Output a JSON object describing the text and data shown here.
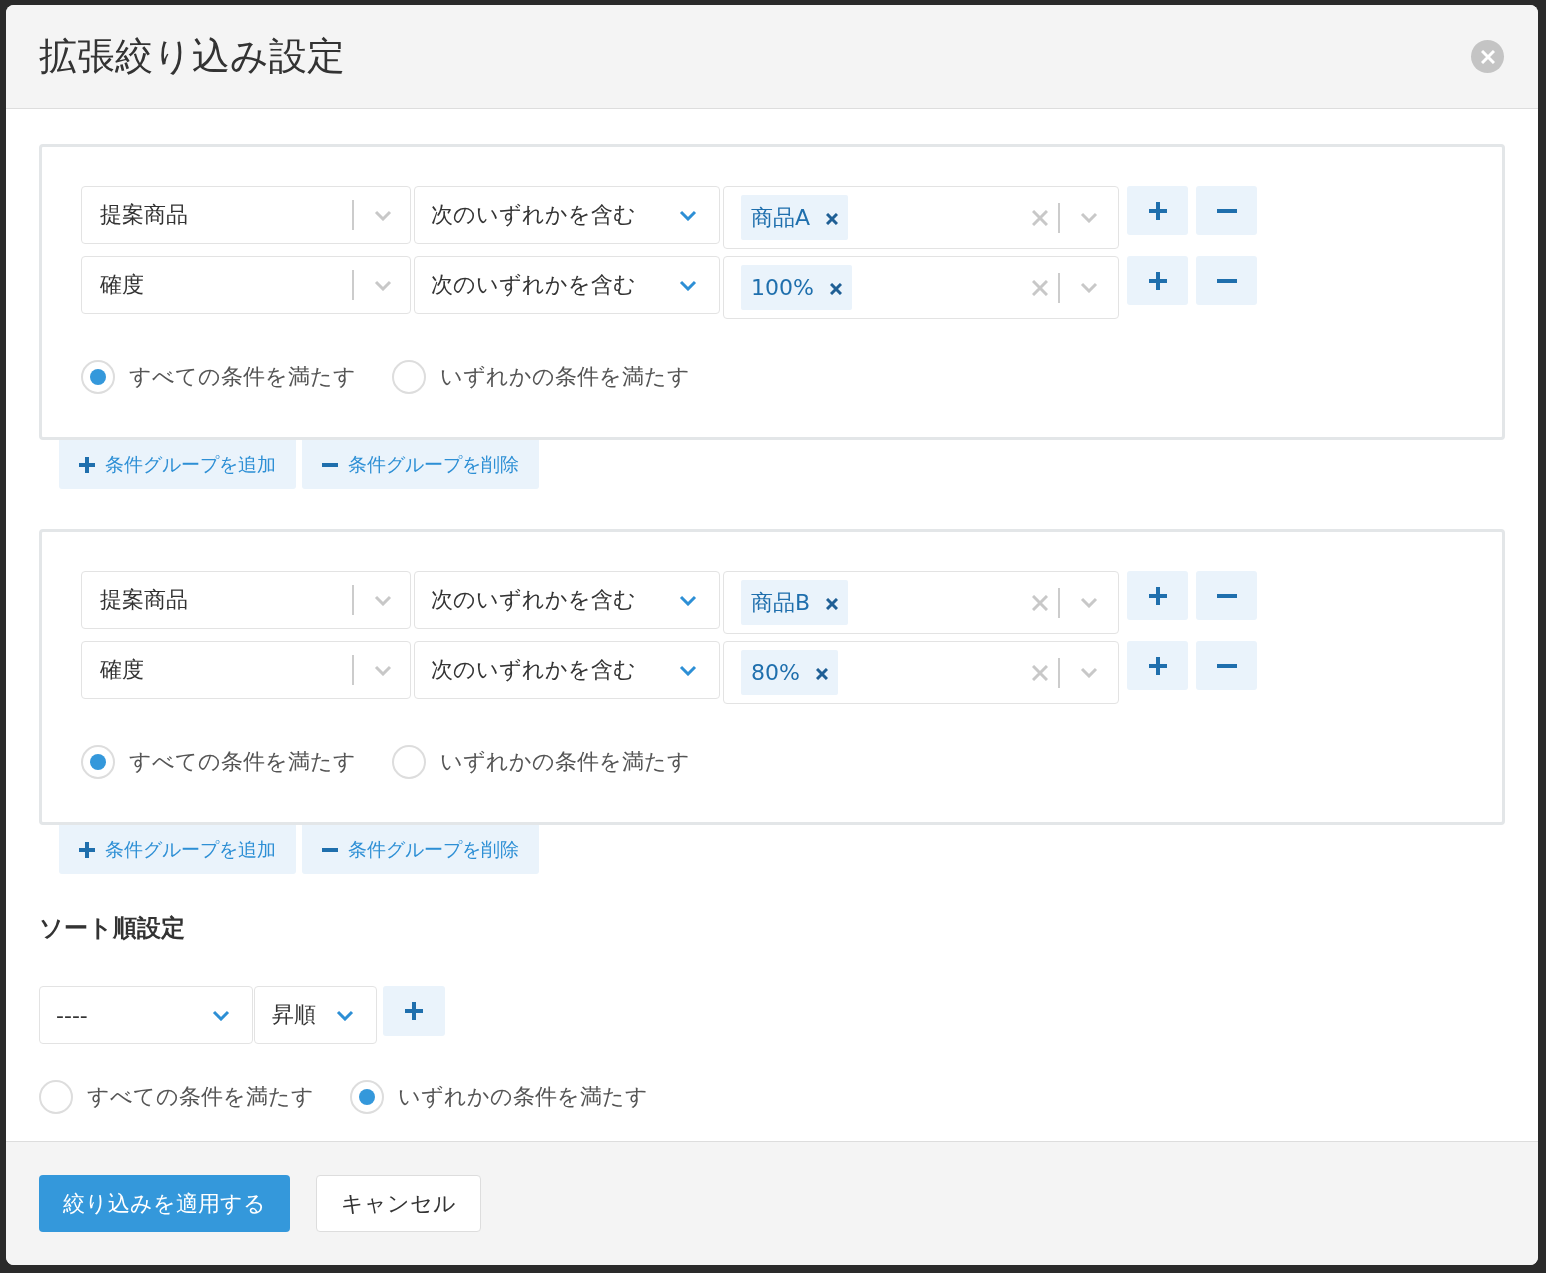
{
  "dialog": {
    "title": "拡張絞り込み設定"
  },
  "condition_groups": [
    {
      "conditions": [
        {
          "field": "提案商品",
          "operator": "次のいずれかを含む",
          "values": [
            "商品A"
          ]
        },
        {
          "field": "確度",
          "operator": "次のいずれかを含む",
          "values": [
            "100%"
          ]
        }
      ],
      "match_options": [
        {
          "label": "すべての条件を満たす",
          "selected": true
        },
        {
          "label": "いずれかの条件を満たす",
          "selected": false
        }
      ],
      "add_group_button": "条件グループを追加",
      "remove_group_button": "条件グループを削除"
    },
    {
      "conditions": [
        {
          "field": "提案商品",
          "operator": "次のいずれかを含む",
          "values": [
            "商品B"
          ]
        },
        {
          "field": "確度",
          "operator": "次のいずれかを含む",
          "values": [
            "80%"
          ]
        }
      ],
      "match_options": [
        {
          "label": "すべての条件を満たす",
          "selected": true
        },
        {
          "label": "いずれかの条件を満たす",
          "selected": false
        }
      ],
      "add_group_button": "条件グループを追加",
      "remove_group_button": "条件グループを削除"
    }
  ],
  "sort": {
    "heading": "ソート順設定",
    "field": "----",
    "order": "昇順",
    "match_options": [
      {
        "label": "すべての条件を満たす",
        "selected": false
      },
      {
        "label": "いずれかの条件を満たす",
        "selected": true
      }
    ]
  },
  "footer": {
    "apply_button": "絞り込みを適用する",
    "cancel_button": "キャンセル"
  }
}
